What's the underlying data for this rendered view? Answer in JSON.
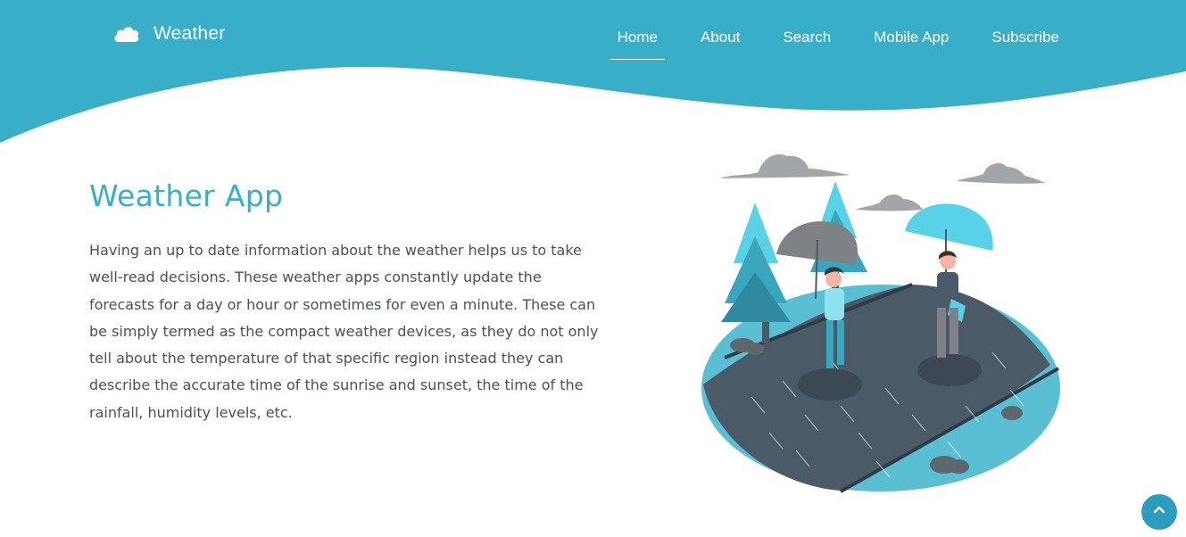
{
  "brand": {
    "name": "Weather",
    "icon": "cloud-icon"
  },
  "nav": {
    "items": [
      {
        "label": "Home",
        "active": true
      },
      {
        "label": "About",
        "active": false
      },
      {
        "label": "Search",
        "active": false
      },
      {
        "label": "Mobile App",
        "active": false
      },
      {
        "label": "Subscribe",
        "active": false
      }
    ]
  },
  "hero": {
    "title": "Weather App",
    "text": "Having an up to date information about the weather helps us to take well-read decisions. These weather apps constantly update the forecasts for a day or hour or sometimes for even a minute. These can be simply termed as the compact weather devices, as they do not only tell about the temperature of that specific region instead they can describe the accurate time of the sunrise and sunset, the time of the rainfall, humidity levels, etc."
  },
  "back_to_top": {
    "icon": "chevron-up-icon"
  },
  "colors": {
    "primary": "#39aec8",
    "text": "#4a4f5e",
    "button": "#2d9cbf",
    "road": "#4b5a67",
    "accent_light": "#5ec3d6"
  }
}
